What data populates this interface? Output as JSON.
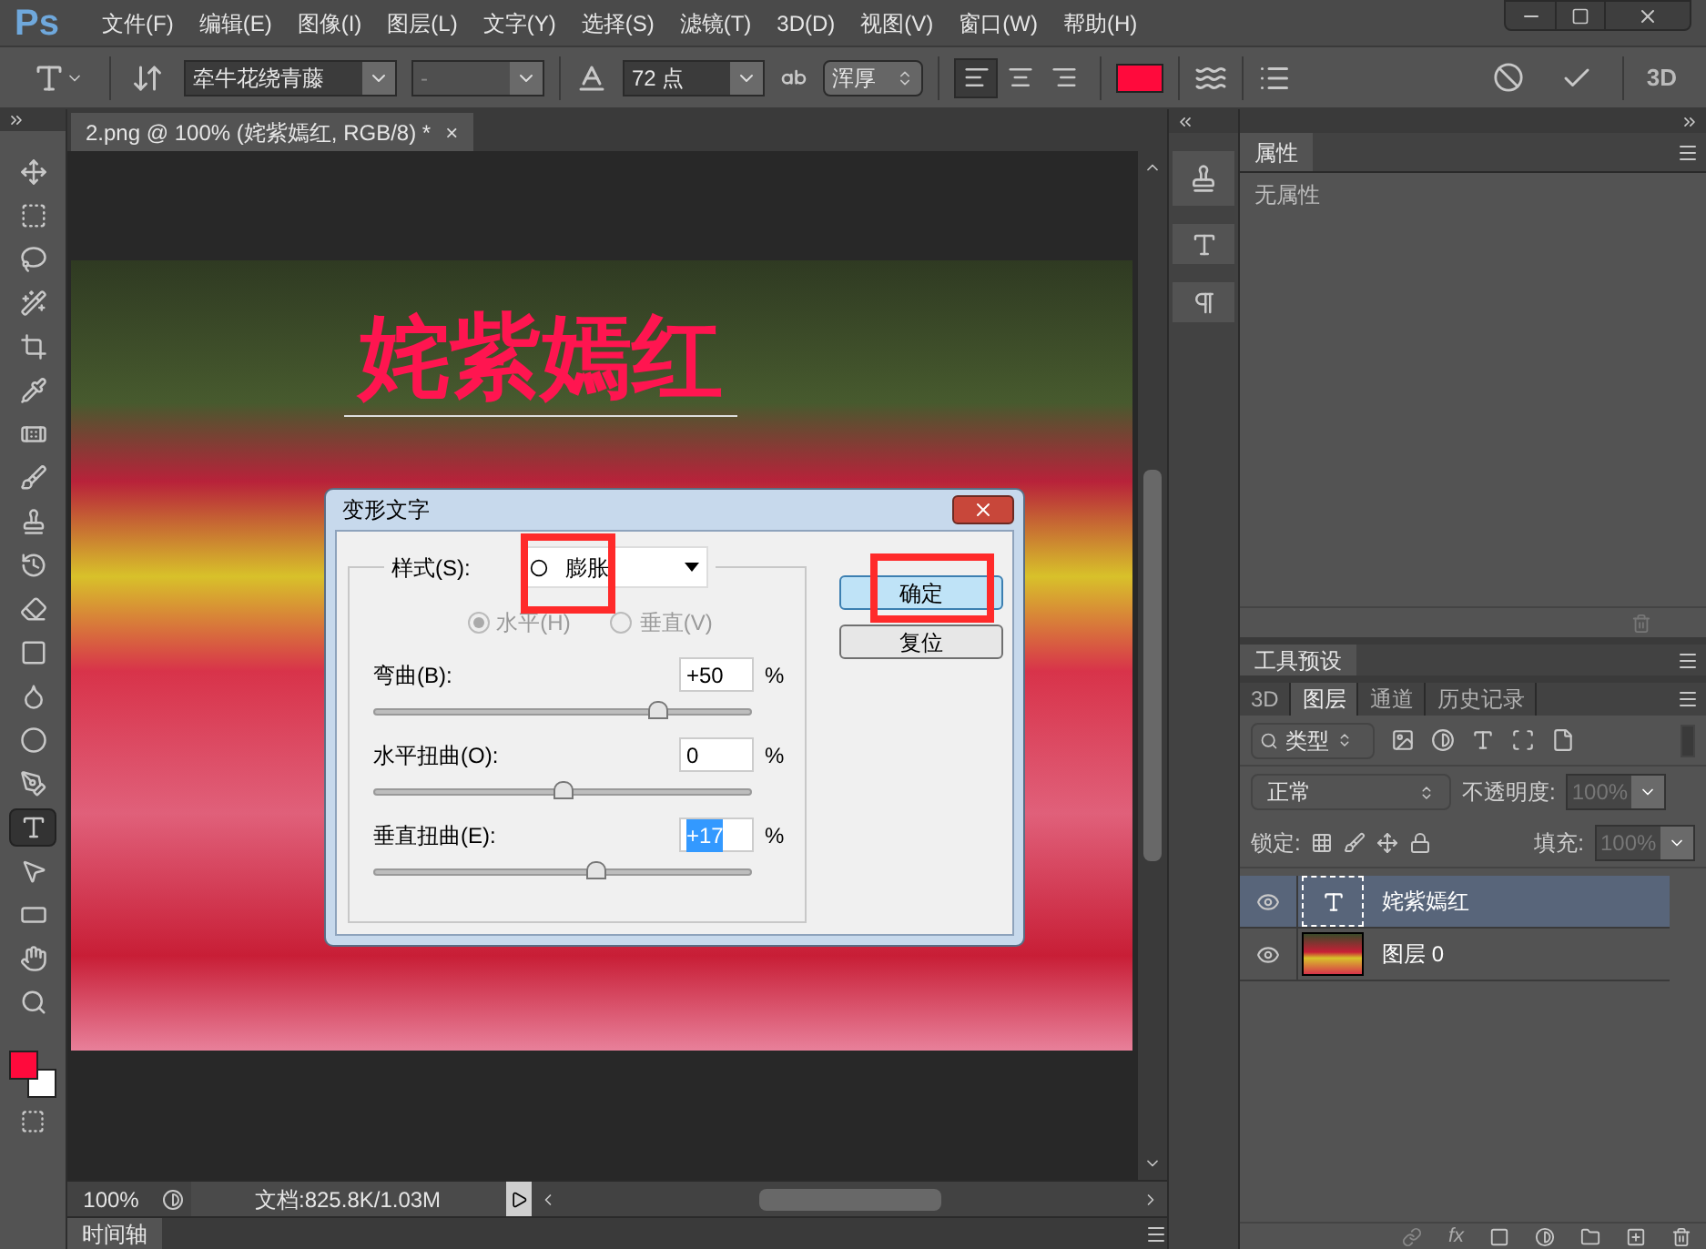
{
  "app": {
    "logo": "Ps"
  },
  "menu": [
    "文件(F)",
    "编辑(E)",
    "图像(I)",
    "图层(L)",
    "文字(Y)",
    "选择(S)",
    "滤镜(T)",
    "3D(D)",
    "视图(V)",
    "窗口(W)",
    "帮助(H)"
  ],
  "options_bar": {
    "font_family": "牵牛花绕青藤",
    "font_style": "-",
    "font_size": "72 点",
    "antialias": "浑厚",
    "alignment": [
      {
        "kind": "left",
        "selected": true
      },
      {
        "kind": "center",
        "selected": false
      },
      {
        "kind": "right",
        "selected": false
      }
    ],
    "mode_3d": "3D"
  },
  "tools": [
    {
      "kind": "move",
      "selected": false
    },
    {
      "kind": "marquee",
      "selected": false
    },
    {
      "kind": "lasso",
      "selected": false
    },
    {
      "kind": "quick-select",
      "selected": false
    },
    {
      "kind": "crop",
      "selected": false
    },
    {
      "kind": "eyedropper",
      "selected": false
    },
    {
      "kind": "healing",
      "selected": false
    },
    {
      "kind": "brush",
      "selected": false
    },
    {
      "kind": "stamp",
      "selected": false
    },
    {
      "kind": "history-brush",
      "selected": false
    },
    {
      "kind": "eraser",
      "selected": false
    },
    {
      "kind": "gradient",
      "selected": false
    },
    {
      "kind": "smudge",
      "selected": false
    },
    {
      "kind": "dodge",
      "selected": false
    },
    {
      "kind": "pen",
      "selected": false
    },
    {
      "kind": "type",
      "selected": true
    },
    {
      "kind": "path-select",
      "selected": false
    },
    {
      "kind": "rectangle",
      "selected": false
    },
    {
      "kind": "hand",
      "selected": false
    },
    {
      "kind": "zoom",
      "selected": false
    }
  ],
  "document": {
    "tab_title": "2.png @ 100% (姹紫嫣红, RGB/8) *",
    "close": "×",
    "canvas_text": "姹紫嫣红"
  },
  "status_bar": {
    "zoom": "100%",
    "doc_info": "文档:825.8K/1.03M"
  },
  "timeline": {
    "title": "时间轴"
  },
  "properties_panel": {
    "title": "属性",
    "content": "无属性"
  },
  "tool_presets_panel": {
    "title": "工具预设"
  },
  "layers_panel": {
    "tabs": [
      {
        "label": "3D",
        "selected": false
      },
      {
        "label": "图层",
        "selected": true
      },
      {
        "label": "通道",
        "selected": false
      },
      {
        "label": "历史记录",
        "selected": false
      }
    ],
    "filter": "类型",
    "blend_mode": "正常",
    "opacity_label": "不透明度:",
    "opacity": "100%",
    "lock_label": "锁定:",
    "fill_label": "填充:",
    "fill": "100%",
    "fx": "fx",
    "layers": [
      {
        "name": "姹紫嫣红",
        "kind": "text",
        "selected": true,
        "visible": true
      },
      {
        "name": "图层 0",
        "kind": "image",
        "selected": false,
        "visible": true
      }
    ]
  },
  "warp_dialog": {
    "title": "变形文字",
    "style_label": "样式(S):",
    "style": "膨胀",
    "orientation": [
      {
        "label": "水平(H)",
        "selected": true,
        "disabled": true
      },
      {
        "label": "垂直(V)",
        "selected": false,
        "disabled": true
      }
    ],
    "sliders": [
      {
        "label": "弯曲(B):",
        "value": "+50",
        "unit": "%",
        "level": 0.75,
        "highlighted": false
      },
      {
        "label": "水平扭曲(O):",
        "value": "0",
        "unit": "%",
        "level": 0.5,
        "highlighted": false
      },
      {
        "label": "垂直扭曲(E):",
        "value": "+17",
        "unit": "%",
        "level": 0.585,
        "highlighted": true
      }
    ],
    "buttons": [
      {
        "label": "确定",
        "kind": "default"
      },
      {
        "label": "复位",
        "kind": "normal"
      }
    ]
  }
}
